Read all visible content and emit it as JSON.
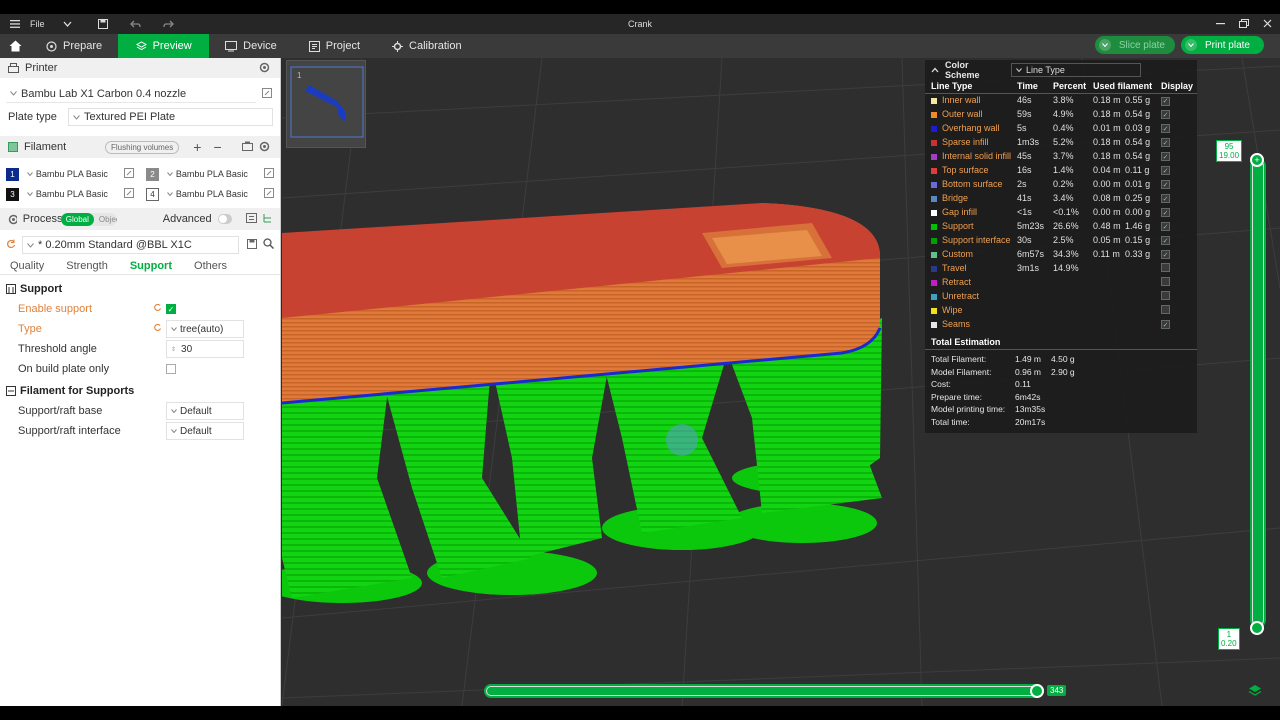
{
  "titlebar": {
    "file_label": "File",
    "title": "Crank"
  },
  "nav": {
    "tabs": [
      {
        "label": "Prepare"
      },
      {
        "label": "Preview"
      },
      {
        "label": "Device"
      },
      {
        "label": "Project"
      },
      {
        "label": "Calibration"
      }
    ],
    "slice_label": "Slice plate",
    "print_label": "Print plate"
  },
  "printer": {
    "section_title": "Printer",
    "name": "Bambu Lab X1 Carbon 0.4 nozzle",
    "plate_type_label": "Plate type",
    "plate_type_value": "Textured PEI Plate"
  },
  "filament": {
    "section_title": "Filament",
    "flushing_label": "Flushing volumes",
    "slots": [
      {
        "num": "1",
        "name": "Bambu PLA Basic",
        "color": "#0a2a8c"
      },
      {
        "num": "2",
        "name": "Bambu PLA Basic",
        "color": "#8a8a8a"
      },
      {
        "num": "3",
        "name": "Bambu PLA Basic",
        "color": "#111111"
      },
      {
        "num": "4",
        "name": "Bambu PLA Basic",
        "color": "#ffffff"
      }
    ]
  },
  "process": {
    "section_title": "Process",
    "global_label": "Global",
    "objects_label": "Objects",
    "advanced_label": "Advanced",
    "profile": "* 0.20mm Standard @BBL X1C",
    "subtabs": [
      "Quality",
      "Strength",
      "Support",
      "Others"
    ],
    "support_group": "Support",
    "enable_support_label": "Enable support",
    "type_label": "Type",
    "type_value": "tree(auto)",
    "threshold_label": "Threshold angle",
    "threshold_value": "30",
    "build_plate_only_label": "On build plate only",
    "filament_group": "Filament for Supports",
    "raft_base_label": "Support/raft base",
    "raft_base_value": "Default",
    "raft_interface_label": "Support/raft interface",
    "raft_interface_value": "Default"
  },
  "viewport": {
    "thumb_num": "1"
  },
  "legend": {
    "title": "Color Scheme",
    "scheme_value": "Line Type",
    "headers": [
      "Line Type",
      "Time",
      "Percent",
      "Used filament",
      "Display"
    ],
    "rows": [
      {
        "name": "Inner wall",
        "color": "#f5e6a0",
        "time": "46s",
        "percent": "3.8%",
        "len": "0.18 m",
        "weight": "0.55 g",
        "display": true
      },
      {
        "name": "Outer wall",
        "color": "#f08a2a",
        "time": "59s",
        "percent": "4.9%",
        "len": "0.18 m",
        "weight": "0.54 g",
        "display": true
      },
      {
        "name": "Overhang wall",
        "color": "#1c1cd8",
        "time": "5s",
        "percent": "0.4%",
        "len": "0.01 m",
        "weight": "0.03 g",
        "display": true
      },
      {
        "name": "Sparse infill",
        "color": "#c83232",
        "time": "1m3s",
        "percent": "5.2%",
        "len": "0.18 m",
        "weight": "0.54 g",
        "display": true
      },
      {
        "name": "Internal solid infill",
        "color": "#a040c0",
        "time": "45s",
        "percent": "3.7%",
        "len": "0.18 m",
        "weight": "0.54 g",
        "display": true
      },
      {
        "name": "Top surface",
        "color": "#e03c3c",
        "time": "16s",
        "percent": "1.4%",
        "len": "0.04 m",
        "weight": "0.11 g",
        "display": true
      },
      {
        "name": "Bottom surface",
        "color": "#6a6ad8",
        "time": "2s",
        "percent": "0.2%",
        "len": "0.00 m",
        "weight": "0.01 g",
        "display": true
      },
      {
        "name": "Bridge",
        "color": "#5a8ac0",
        "time": "41s",
        "percent": "3.4%",
        "len": "0.08 m",
        "weight": "0.25 g",
        "display": true
      },
      {
        "name": "Gap infill",
        "color": "#ffffff",
        "time": "<1s",
        "percent": "<0.1%",
        "len": "0.00 m",
        "weight": "0.00 g",
        "display": true
      },
      {
        "name": "Support",
        "color": "#00c000",
        "time": "5m23s",
        "percent": "26.6%",
        "len": "0.48 m",
        "weight": "1.46 g",
        "display": true
      },
      {
        "name": "Support interface",
        "color": "#00a000",
        "time": "30s",
        "percent": "2.5%",
        "len": "0.05 m",
        "weight": "0.15 g",
        "display": true
      },
      {
        "name": "Custom",
        "color": "#5ec08a",
        "time": "6m57s",
        "percent": "34.3%",
        "len": "0.11 m",
        "weight": "0.33 g",
        "display": true
      },
      {
        "name": "Travel",
        "color": "#2a3a8a",
        "time": "3m1s",
        "percent": "14.9%",
        "len": "",
        "weight": "",
        "display": false
      },
      {
        "name": "Retract",
        "color": "#c020c0",
        "time": "",
        "percent": "",
        "len": "",
        "weight": "",
        "display": false
      },
      {
        "name": "Unretract",
        "color": "#40a0c0",
        "time": "",
        "percent": "",
        "len": "",
        "weight": "",
        "display": false
      },
      {
        "name": "Wipe",
        "color": "#f0e020",
        "time": "",
        "percent": "",
        "len": "",
        "weight": "",
        "display": false
      },
      {
        "name": "Seams",
        "color": "#e6e6e6",
        "time": "",
        "percent": "",
        "len": "",
        "weight": "",
        "display": true
      }
    ],
    "estimation_title": "Total Estimation",
    "estimation": [
      {
        "k": "Total Filament:",
        "v1": "1.49 m",
        "v2": "4.50 g"
      },
      {
        "k": "Model Filament:",
        "v1": "0.96 m",
        "v2": "2.90 g"
      },
      {
        "k": "Cost:",
        "v1": "0.11",
        "v2": ""
      },
      {
        "k": "Prepare time:",
        "v1": "6m42s",
        "v2": ""
      },
      {
        "k": "Model printing time:",
        "v1": "13m35s",
        "v2": ""
      },
      {
        "k": "Total time:",
        "v1": "20m17s",
        "v2": ""
      }
    ]
  },
  "layer_slider": {
    "top_layer": "95",
    "top_height": "19.00",
    "bottom_layer": "1",
    "bottom_height": "0.20"
  },
  "move_slider": {
    "value": "343"
  },
  "colors": {
    "accent": "#00ae42",
    "support": "#00c000",
    "outer_wall": "#f08a2a",
    "top_surface": "#c83232"
  }
}
